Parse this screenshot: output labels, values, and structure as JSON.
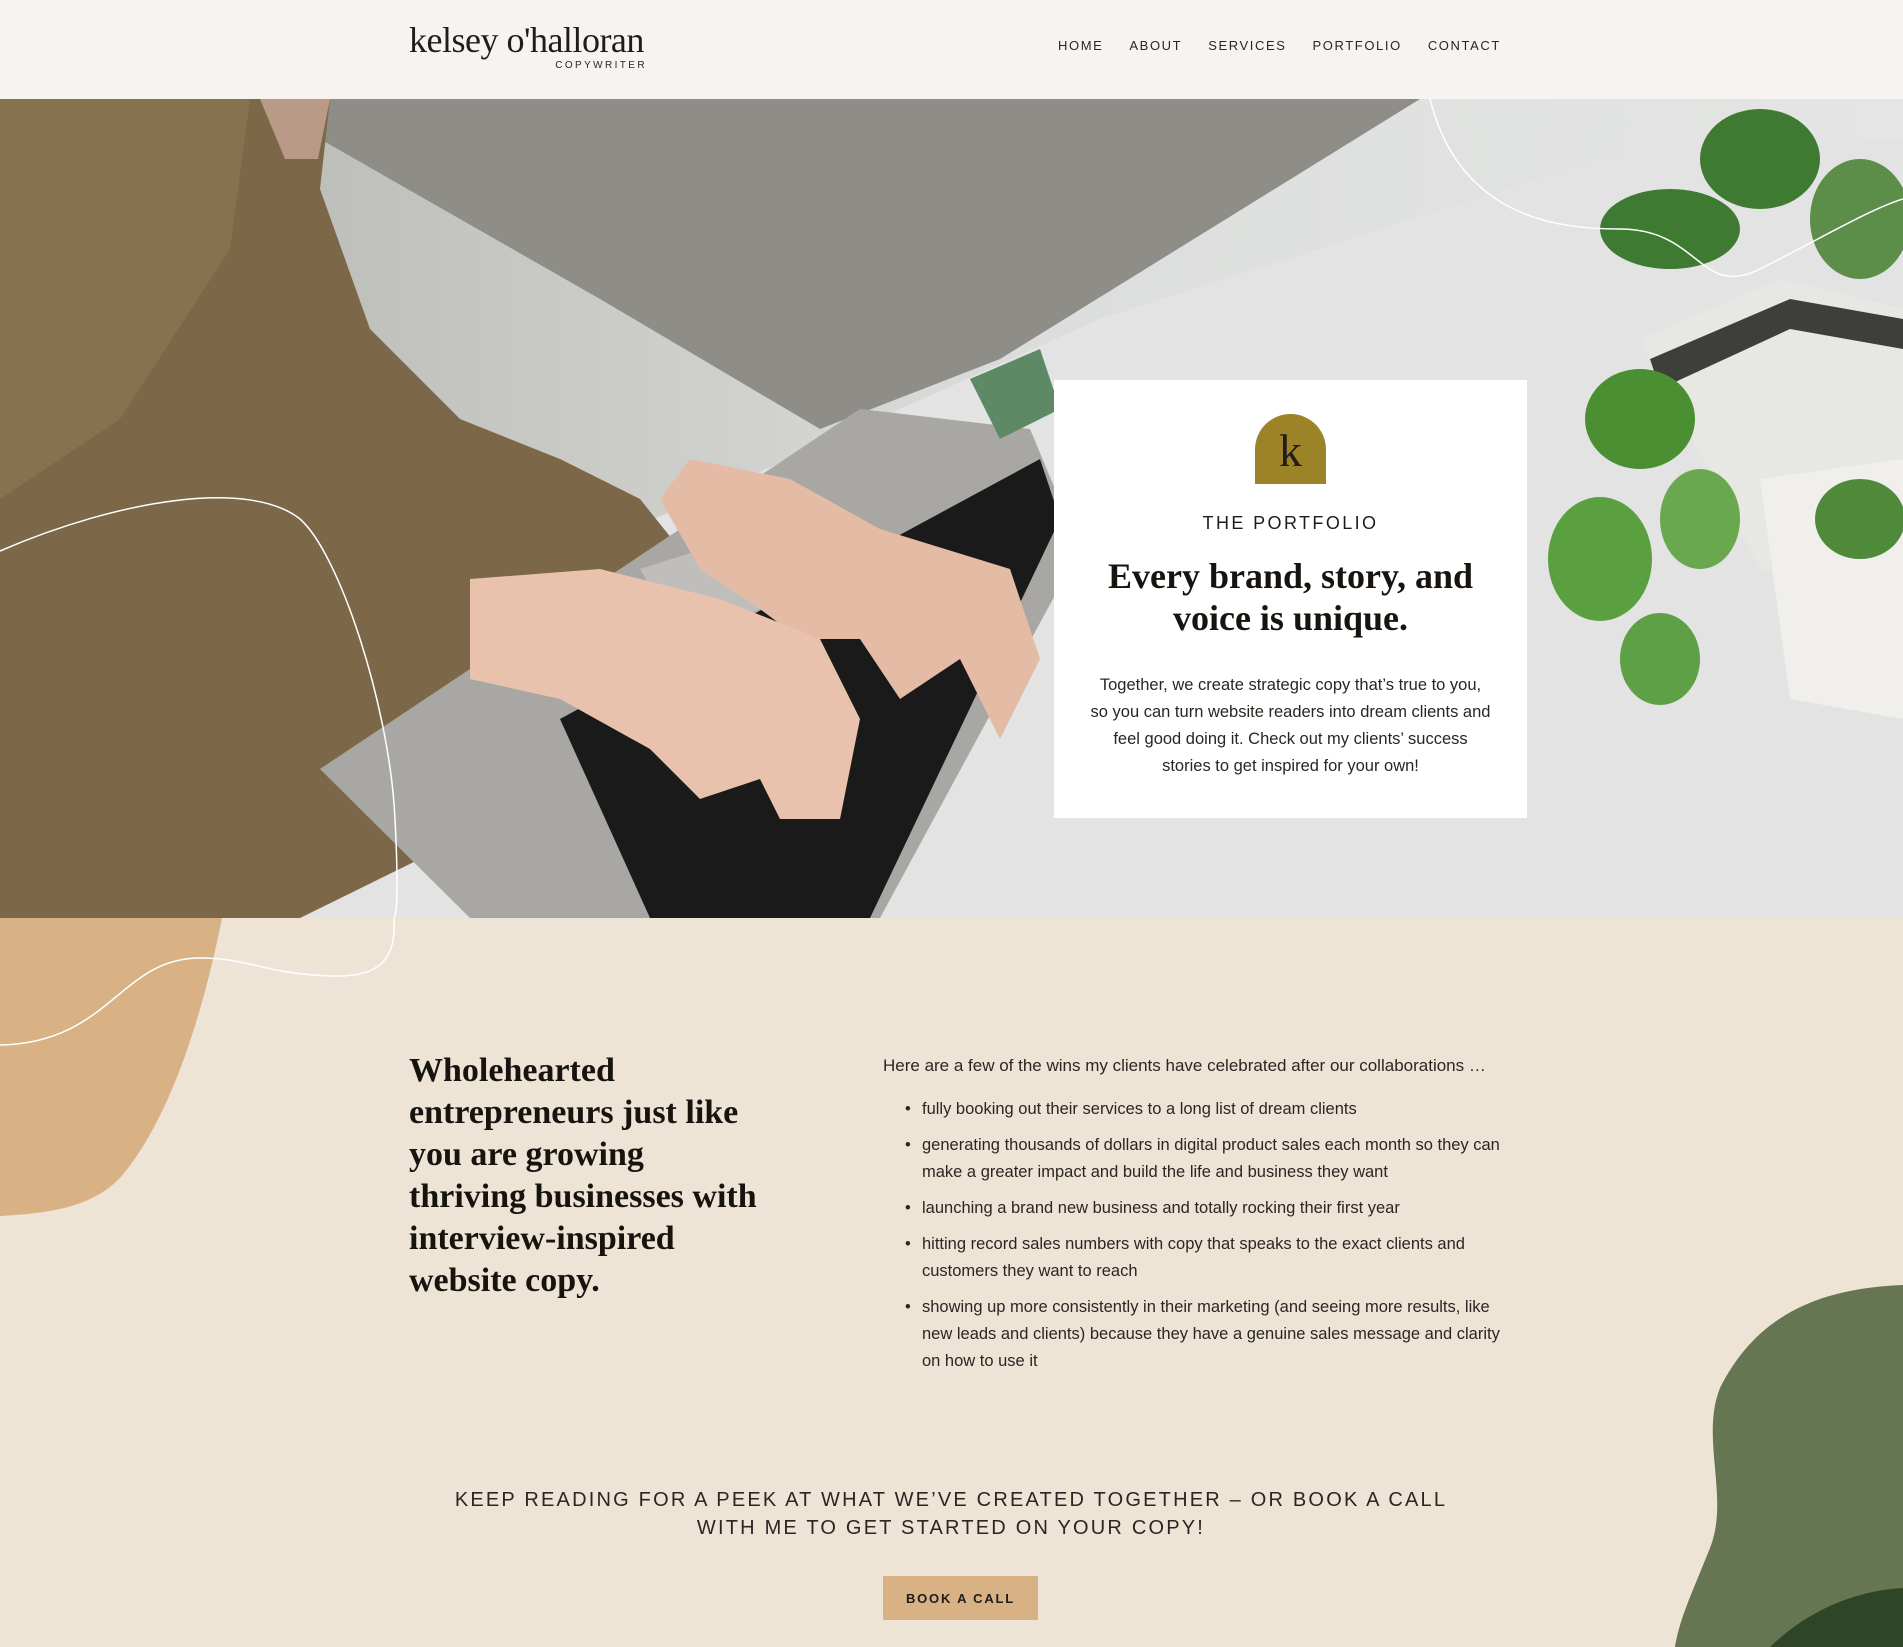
{
  "header": {
    "logo_name": "kelsey o'halloran",
    "logo_sub": "COPYWRITER",
    "nav": [
      "HOME",
      "ABOUT",
      "SERVICES",
      "PORTFOLIO",
      "CONTACT"
    ]
  },
  "hero": {
    "badge_letter": "k",
    "eyebrow": "THE PORTFOLIO",
    "title": "Every brand, story, and voice is unique.",
    "body": "Together, we create strategic copy that’s true to you, so you can turn website readers into dream clients and feel good doing it. Check out my clients’ success stories to get inspired for your own!"
  },
  "wins": {
    "title": "Wholehearted entrepreneurs just like you are growing thriving businesses with interview-inspired website copy.",
    "intro": "Here are a few of the wins my clients have celebrated after our collaborations …",
    "items": [
      "fully booking out their services to a long list of dream clients",
      "generating thousands of dollars in digital product sales each month so they can make a greater impact and build the life and business they want",
      "launching a brand new business and totally rocking their first year",
      "hitting record sales numbers with copy that speaks to the exact clients and customers they want to reach",
      "showing up more consistently in their marketing (and seeing more results, like new leads and clients) because they have a genuine sales message and clarity on how to use it"
    ]
  },
  "cta": {
    "text": "KEEP READING FOR A PEEK AT WHAT WE’VE CREATED TOGETHER – OR BOOK A CALL WITH ME TO GET STARTED ON YOUR COPY!",
    "button": "BOOK A CALL"
  },
  "colors": {
    "header_bg": "#f6f3f0",
    "section_bg": "#ede4d6",
    "badge_gold": "#9d8328",
    "button_tan": "#d8b285",
    "blob_tan": "#d8b285",
    "blob_green": "#667552"
  },
  "hero_image": "woman-typing-on-laptop-with-plants"
}
